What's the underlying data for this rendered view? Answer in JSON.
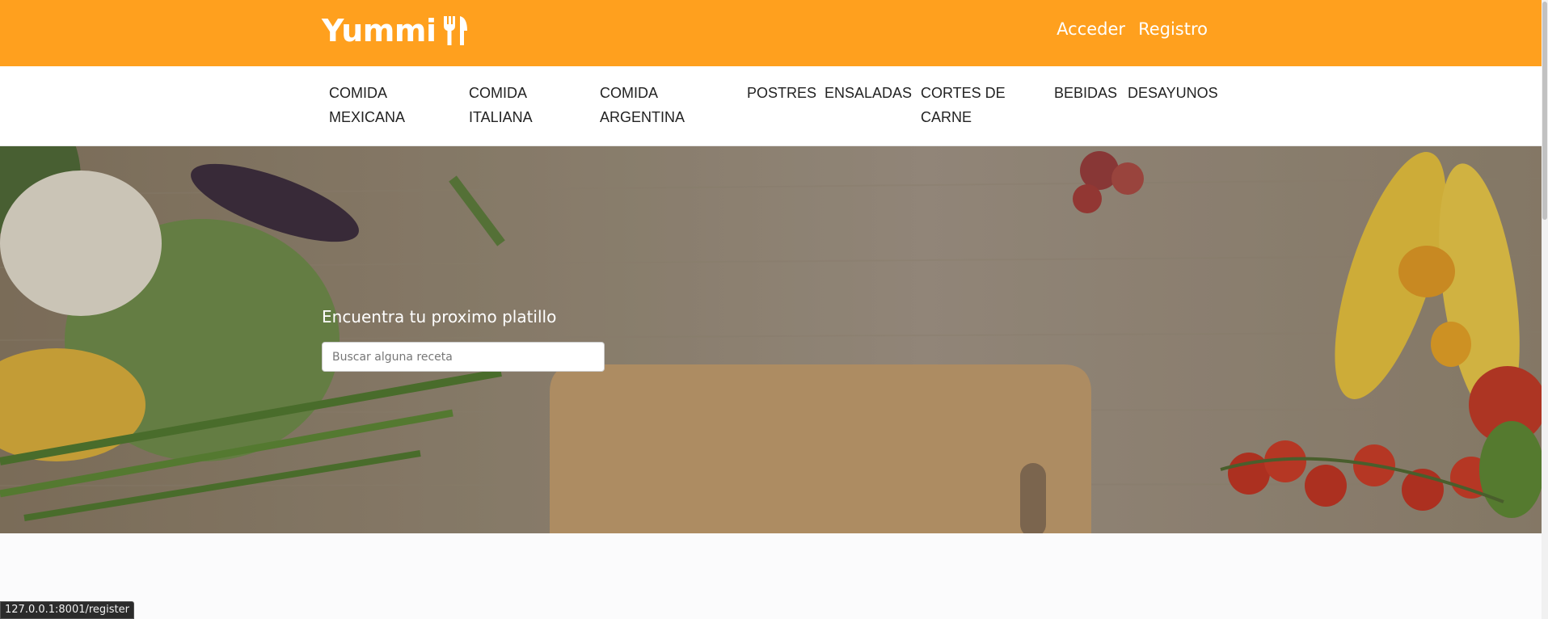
{
  "header": {
    "brand": "Yummi",
    "brand_icon": "fork-knife-icon",
    "login": "Acceder",
    "register": "Registro",
    "color": "#ffa01e"
  },
  "categories": [
    "Comida Mexicana",
    "Comida Italiana",
    "Comida Argentina",
    "Postres",
    "Ensaladas",
    "Cortes de Carne",
    "Bebidas",
    "Desayunos"
  ],
  "hero": {
    "title": "Encuentra tu proximo platillo",
    "search_placeholder": "Buscar alguna receta",
    "search_value": ""
  },
  "status_bar": {
    "url": "127.0.0.1:8001/register"
  }
}
